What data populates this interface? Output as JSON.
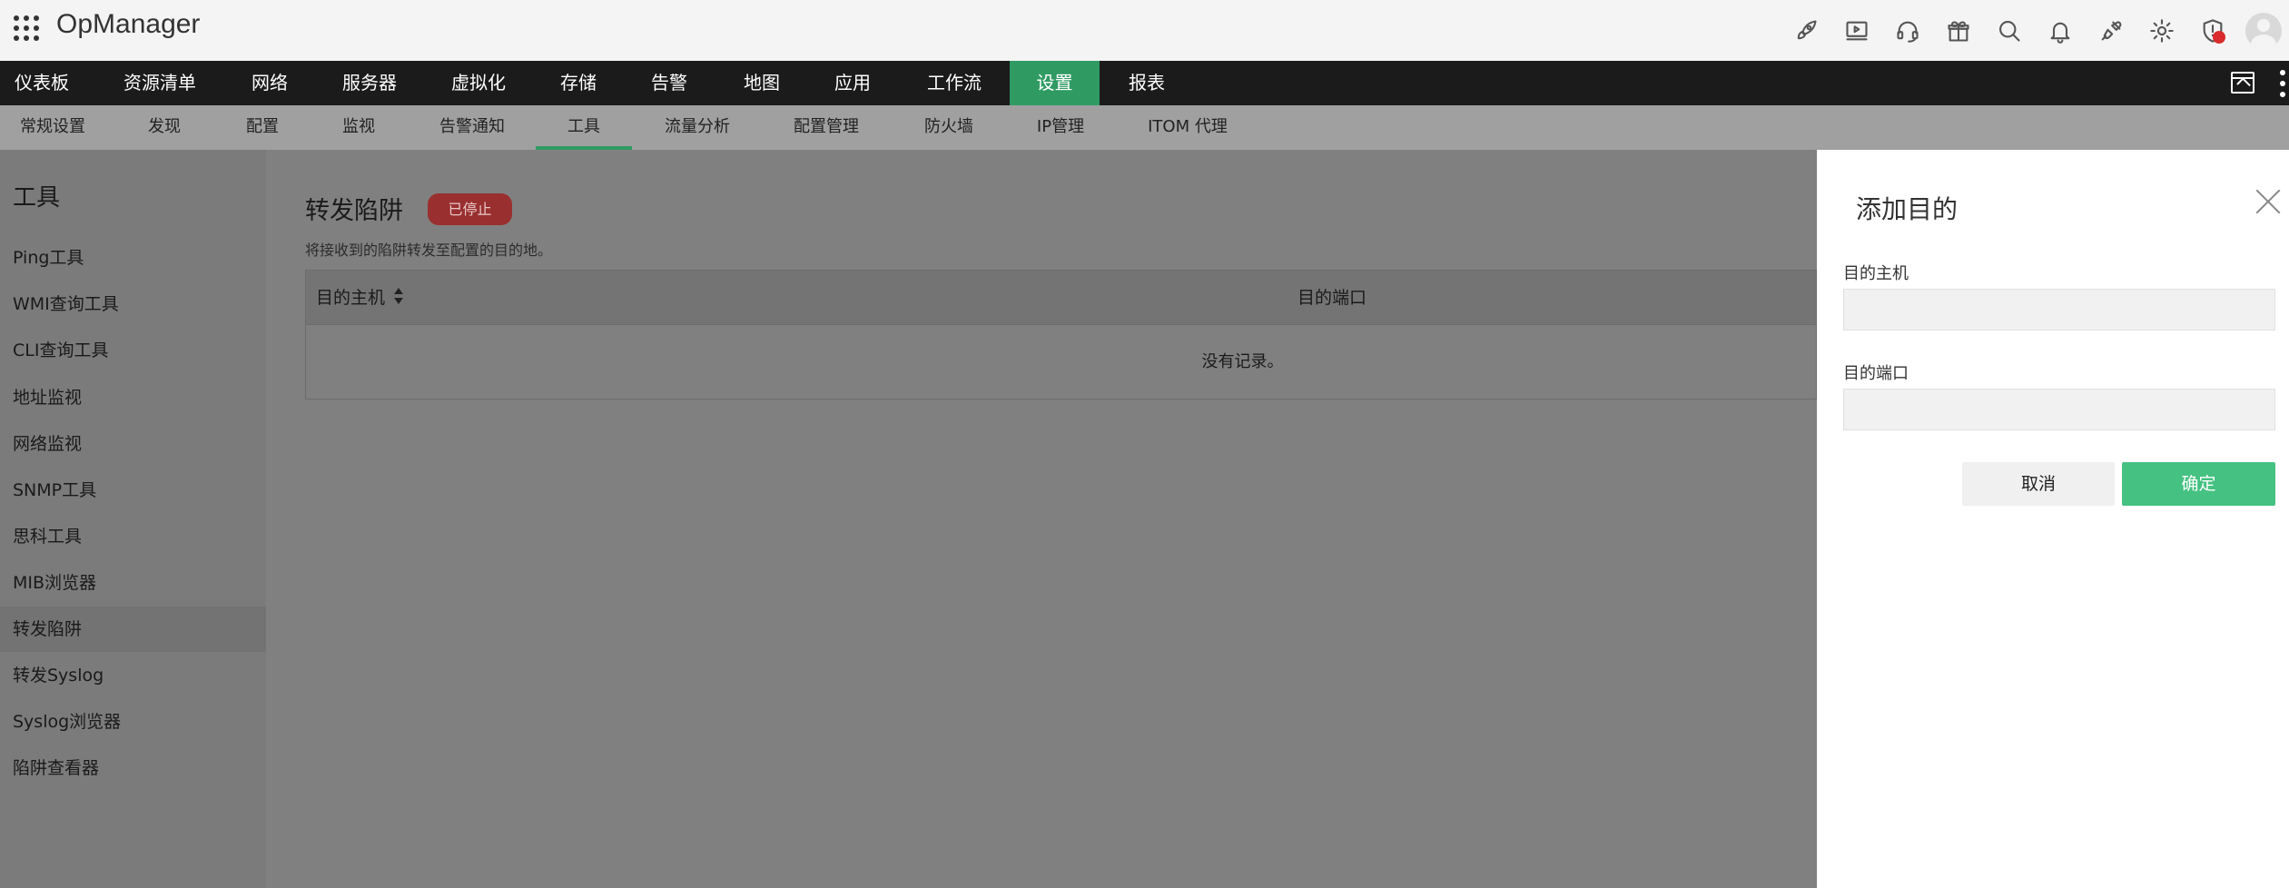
{
  "app": {
    "title": "OpManager"
  },
  "main_nav": [
    {
      "label": "仪表板"
    },
    {
      "label": "资源清单"
    },
    {
      "label": "网络"
    },
    {
      "label": "服务器"
    },
    {
      "label": "虚拟化"
    },
    {
      "label": "存储"
    },
    {
      "label": "告警"
    },
    {
      "label": "地图"
    },
    {
      "label": "应用"
    },
    {
      "label": "工作流"
    },
    {
      "label": "设置",
      "active": true
    },
    {
      "label": "报表"
    }
  ],
  "sub_nav": [
    {
      "label": "常规设置"
    },
    {
      "label": "发现"
    },
    {
      "label": "配置"
    },
    {
      "label": "监视"
    },
    {
      "label": "告警通知"
    },
    {
      "label": "工具",
      "active": true
    },
    {
      "label": "流量分析"
    },
    {
      "label": "配置管理"
    },
    {
      "label": "防火墙"
    },
    {
      "label": "IP管理"
    },
    {
      "label": "ITOM 代理"
    }
  ],
  "sidebar": {
    "title": "工具",
    "items": [
      {
        "label": "Ping工具"
      },
      {
        "label": "WMI查询工具"
      },
      {
        "label": "CLI查询工具"
      },
      {
        "label": "地址监视"
      },
      {
        "label": "网络监视"
      },
      {
        "label": "SNMP工具"
      },
      {
        "label": "思科工具"
      },
      {
        "label": "MIB浏览器"
      },
      {
        "label": "转发陷阱",
        "active": true
      },
      {
        "label": "转发Syslog"
      },
      {
        "label": "Syslog浏览器"
      },
      {
        "label": "陷阱查看器"
      }
    ]
  },
  "content": {
    "title": "转发陷阱",
    "status": "已停止",
    "description": "将接收到的陷阱转发至配置的目的地。",
    "table": {
      "columns": [
        "目的主机",
        "目的端口"
      ],
      "empty_message": "没有记录。"
    }
  },
  "drawer": {
    "title": "添加目的",
    "fields": [
      {
        "label": "目的主机",
        "value": "",
        "placeholder": ""
      },
      {
        "label": "目的端口",
        "value": "",
        "placeholder": ""
      }
    ],
    "cancel_label": "取消",
    "ok_label": "确定"
  },
  "colors": {
    "accent_green": "#45c181",
    "nav_active": "#2f9b63",
    "status_stopped": "#c94343",
    "alert_dot": "#d92b2b"
  },
  "top_icons": [
    "rocket-icon",
    "video-icon",
    "headset-icon",
    "gift-icon",
    "search-icon",
    "bell-icon",
    "plug-icon",
    "gear-icon",
    "alert-shield-icon"
  ]
}
